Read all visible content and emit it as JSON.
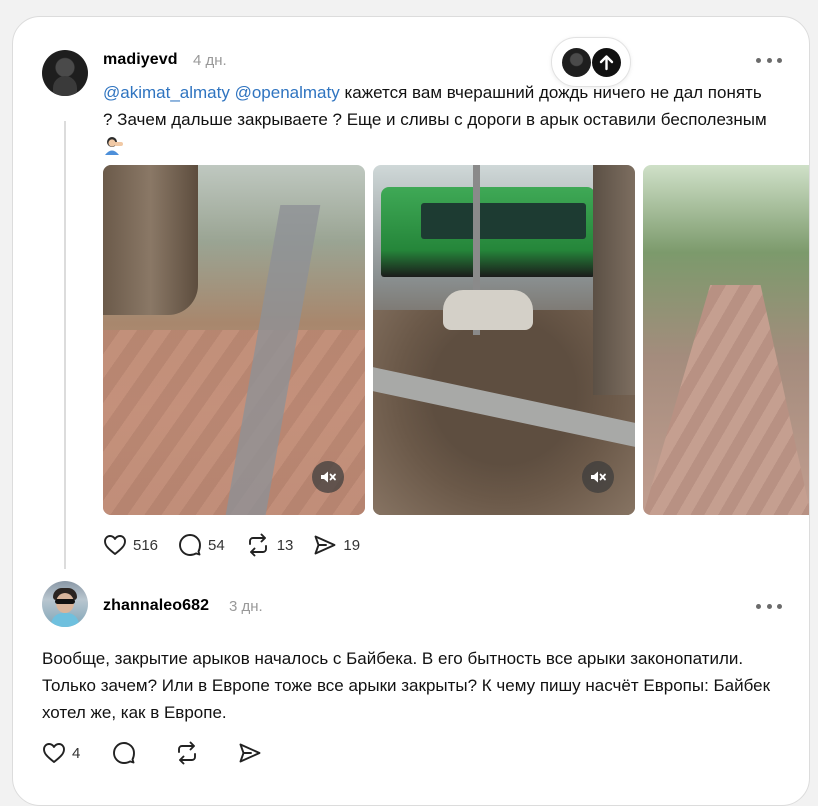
{
  "post": {
    "username": "madiyevd",
    "time": "4 дн.",
    "mention1": "@akimat_almaty",
    "mention2": "@openalmaty",
    "text_part1": " кажется вам вчерашний дождь ничего не дал понять ? Зачем дальше закрываете ? Еще и сливы с дороги в арык оставили бесполезным",
    "emoji": "person-facepalming-emoji",
    "media": [
      {
        "type": "video",
        "muted": true
      },
      {
        "type": "video",
        "muted": true
      },
      {
        "type": "image"
      }
    ],
    "actions": {
      "likes": "516",
      "comments": "54",
      "reposts": "13",
      "shares": "19"
    }
  },
  "reply": {
    "username": "zhannaleo682",
    "time": "3 дн.",
    "text": "Вообще, закрытие арыков началось с Байбека. В его бытность все арыки законопатили. Только зачем? Или в Европе тоже все арыки закрыты? К чему пишу насчёт Европы: Байбек хотел же, как в Европе.",
    "actions": {
      "likes": "4"
    }
  },
  "icons": {
    "more": "more-icon",
    "scroll_top": "arrow-up-icon",
    "like": "heart-icon",
    "comment": "comment-icon",
    "repost": "repost-icon",
    "share": "share-icon",
    "mute": "volume-muted-icon"
  },
  "colors": {
    "mention": "#2f74c0",
    "secondary_text": "#999999",
    "background": "#f2f2f2"
  }
}
